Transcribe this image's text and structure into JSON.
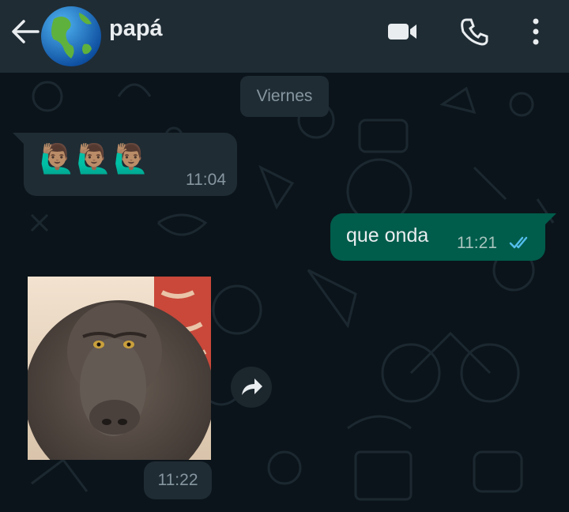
{
  "header": {
    "contact_name": "papá",
    "icons": [
      "back-arrow-icon",
      "globe-avatar",
      "video-call-icon",
      "phone-icon",
      "more-options-icon"
    ]
  },
  "chat": {
    "date_label": "Viernes",
    "messages": [
      {
        "direction": "incoming",
        "text": "🙋🏽‍♂️🙋🏽‍♂️🙋🏽‍♂️",
        "time": "11:04"
      },
      {
        "direction": "outgoing",
        "text": "que onda",
        "time": "11:21",
        "status": "read"
      },
      {
        "direction": "incoming",
        "type": "image",
        "subject": "baboon photo",
        "time": "11:22"
      }
    ]
  },
  "colors": {
    "background": "#0b141a",
    "header": "#1f2c34",
    "incoming_bubble": "#1f2c34",
    "outgoing_bubble": "#005c4b",
    "read_ticks": "#53bdeb",
    "secondary_text": "#8696a0"
  }
}
